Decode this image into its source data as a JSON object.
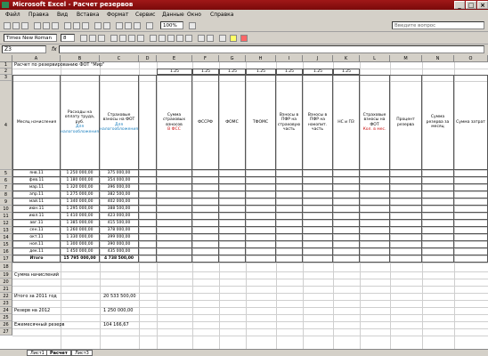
{
  "window": {
    "title": "Microsoft Excel - Расчет резервов",
    "min": "_",
    "max": "□",
    "close": "×"
  },
  "menu": [
    "Файл",
    "Правка",
    "Вид",
    "Вставка",
    "Формат",
    "Сервис",
    "Данные",
    "Окно",
    "Справка"
  ],
  "toolbar": {
    "font_name": "Times New Roman",
    "font_size": "8",
    "zoom": "100%",
    "help_placeholder": "Введите вопрос"
  },
  "formula": {
    "cell_ref": "Z3",
    "fx": "fx"
  },
  "sheet": {
    "column_letters": [
      "A",
      "B",
      "C",
      "D",
      "E",
      "F",
      "G",
      "H",
      "I",
      "J",
      "K",
      "L",
      "M",
      "N",
      "O"
    ],
    "title_text": "Расчет по резервированию ФОТ \"Мир\"",
    "top_numbers": [
      "1.25",
      "1.25",
      "1.25",
      "1.25",
      "1.25",
      "1.25",
      "1.25"
    ],
    "headers": {
      "col_a": "Месяц начисления",
      "col_b_black": "Расходы на оплату труда, руб.",
      "col_b_blue": "Для налогообложения",
      "col_c_black": "Страховые взносы на ФОТ",
      "col_c_blue": "Для налогообложения",
      "col_d_black": "Сумма страховых взносов",
      "col_d_red": "В ФСС",
      "col_e": "ФССРФ",
      "col_f": "ФОМС",
      "col_g": "ТФОМС",
      "col_h": "Взносы в ПФР на страховую часть",
      "col_i": "Взносы в ПФР на накопит. часть",
      "col_j": "НС и ПЗ",
      "col_k_black": "Страховые взносы на ФОТ",
      "col_k_red": "Кол. в мес.",
      "col_l": "Процент резерва",
      "col_m": "Сумма резерва за месяц",
      "col_n": "Сумма затрат"
    },
    "months": [
      "янв.11",
      "фев.11",
      "мар.11",
      "апр.11",
      "май.11",
      "июн.11",
      "июл.11",
      "авг.11",
      "сен.11",
      "окт.11",
      "ноя.11",
      "дек.11"
    ],
    "b_values": [
      "1 250 000,00",
      "1 180 000,00",
      "1 320 000,00",
      "1 275 000,00",
      "1 340 000,00",
      "1 295 000,00",
      "1 410 000,00",
      "1 385 000,00",
      "1 260 000,00",
      "1 330 000,00",
      "1 300 000,00",
      "1 450 000,00"
    ],
    "c_values": [
      "375 000,00",
      "354 000,00",
      "396 000,00",
      "382 500,00",
      "402 000,00",
      "388 500,00",
      "423 000,00",
      "415 500,00",
      "378 000,00",
      "399 000,00",
      "390 000,00",
      "435 000,00"
    ],
    "total_label": "Итого",
    "total_b": "15 795 000,00",
    "total_c": "4 738 500,00",
    "footer_rows": [
      {
        "label": "Сумма начислений",
        "value": ""
      },
      {
        "label": "Итого за 2011 год",
        "value": "20 533 500,00"
      },
      {
        "label": "Резерв на 2012",
        "value": "1 250 000,00"
      },
      {
        "label": "Ежемесячный резерв",
        "value": "104 166,67"
      }
    ],
    "row_numbers": [
      "1",
      "2",
      "3",
      "4",
      "5",
      "6",
      "7",
      "8",
      "9",
      "10",
      "11",
      "12",
      "13",
      "14",
      "15",
      "16",
      "17",
      "18",
      "19",
      "20",
      "21",
      "22",
      "23",
      "24",
      "25",
      "26",
      "27"
    ]
  },
  "sheet_tabs": [
    "Лист1",
    "Расчет",
    "Лист3"
  ]
}
